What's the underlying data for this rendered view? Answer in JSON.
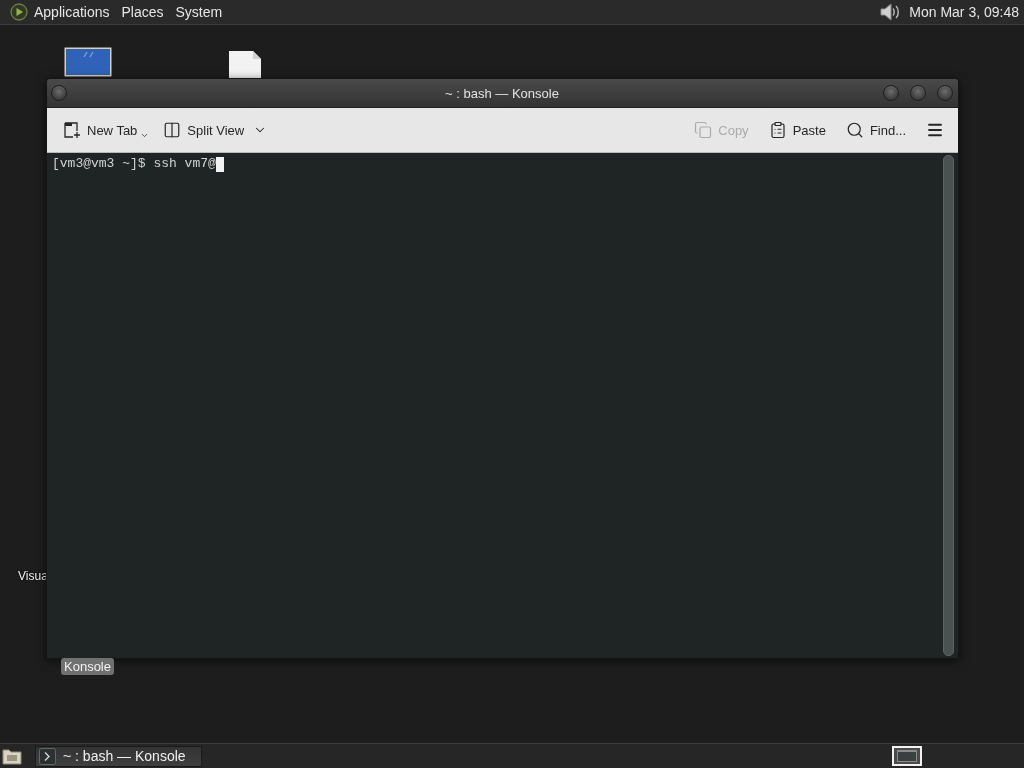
{
  "top_panel": {
    "menus": [
      {
        "label": "Applications"
      },
      {
        "label": "Places"
      },
      {
        "label": "System"
      }
    ],
    "clock": "Mon Mar 3, 09:48"
  },
  "desktop": {
    "icons": [
      {
        "kind": "monitor"
      },
      {
        "kind": "document"
      }
    ],
    "labels": [
      {
        "text": "Visua",
        "selected": false
      },
      {
        "text": "Konsole",
        "selected": true
      }
    ]
  },
  "window": {
    "title": "~ : bash — Konsole",
    "toolbar": {
      "left": [
        {
          "kind": "new-tab",
          "label": "New Tab",
          "disabled": false,
          "dropdown": true
        },
        {
          "kind": "split-view",
          "label": "Split View",
          "disabled": false,
          "dropdown": true
        }
      ],
      "right": [
        {
          "kind": "copy",
          "label": "Copy",
          "disabled": true
        },
        {
          "kind": "paste",
          "label": "Paste",
          "disabled": false
        },
        {
          "kind": "find",
          "label": "Find...",
          "disabled": false
        },
        {
          "kind": "menu",
          "disabled": false
        }
      ]
    },
    "terminal": {
      "lines": [
        "[vm3@vm3 ~]$ ssh vm7@"
      ],
      "cursor": true
    }
  },
  "taskbar": {
    "tasks": [
      {
        "label": "~ : bash — Konsole",
        "selected": true
      }
    ],
    "workspaces": [
      {
        "selected": true
      }
    ]
  }
}
